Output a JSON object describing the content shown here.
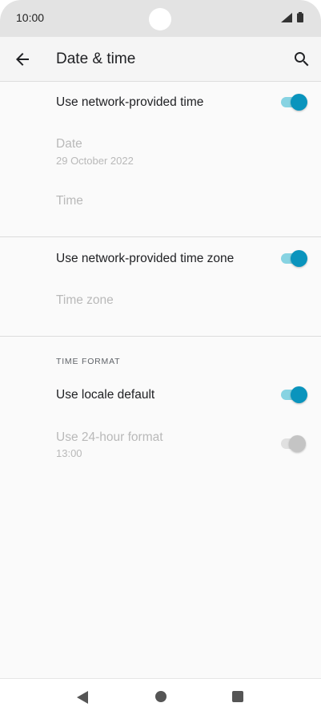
{
  "status_bar": {
    "time": "10:00"
  },
  "app_bar": {
    "title": "Date & time"
  },
  "settings": {
    "network_time": {
      "title": "Use network-provided time",
      "enabled": true
    },
    "date": {
      "title": "Date",
      "summary": "29 October 2022"
    },
    "time": {
      "title": "Time"
    },
    "network_time_zone": {
      "title": "Use network-provided time zone",
      "enabled": true
    },
    "time_zone": {
      "title": "Time zone"
    },
    "time_format_header": "TIME FORMAT",
    "locale_default": {
      "title": "Use locale default",
      "enabled": true
    },
    "format_24h": {
      "title": "Use 24-hour format",
      "summary": "13:00",
      "enabled": false
    }
  },
  "colors": {
    "accent": "#0a94bd",
    "accent_track": "#87d3e2",
    "disabled_text": "#b9b9b9"
  },
  "icons": {
    "back": "arrow-left",
    "search": "magnifier",
    "nav_back": "triangle-left",
    "nav_home": "circle",
    "nav_recents": "square"
  }
}
